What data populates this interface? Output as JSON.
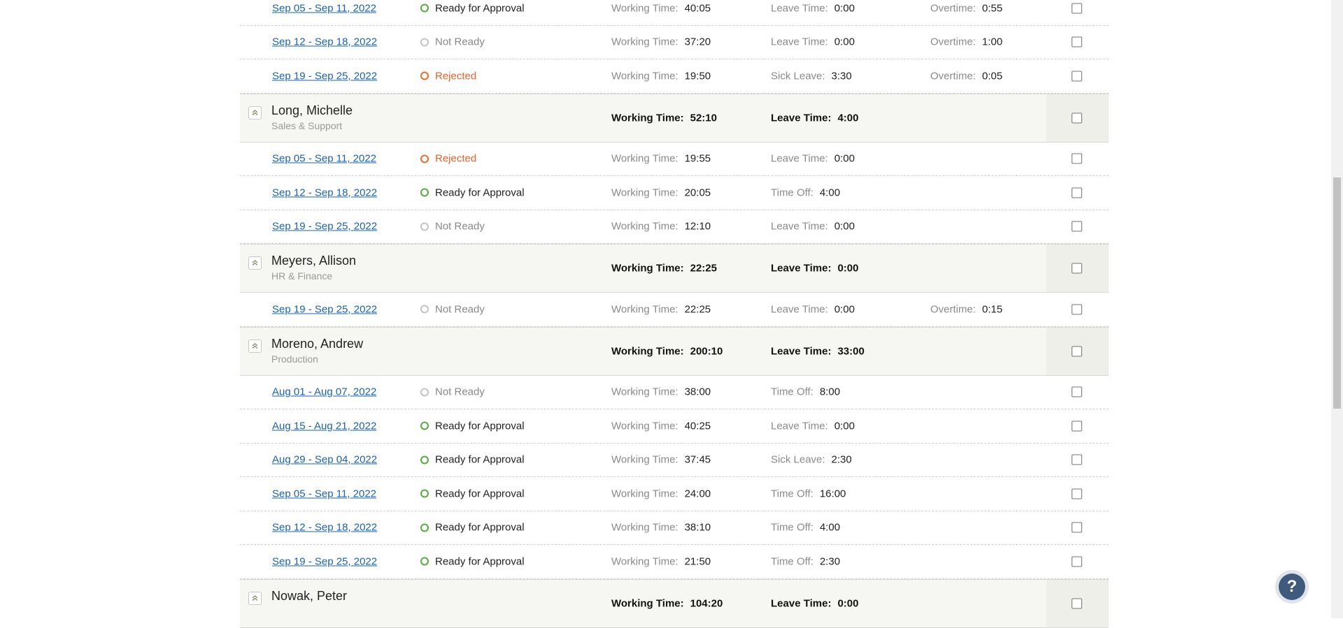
{
  "labels": {
    "working_time": "Working Time:",
    "leave_time": "Leave Time:",
    "overtime": "Overtime:",
    "sick_leave": "Sick Leave:",
    "time_off": "Time Off:"
  },
  "statuses": {
    "ready": "Ready for Approval",
    "not_ready": "Not Ready",
    "rejected": "Rejected"
  },
  "rows": [
    {
      "kind": "week",
      "date": "Sep 05 - Sep 11, 2022",
      "status": "Ready for Approval",
      "status_color": "green",
      "m1_label": "Working Time:",
      "m1_value": "40:05",
      "m2_label": "Leave Time:",
      "m2_value": "0:00",
      "m3_label": "Overtime:",
      "m3_value": "0:55"
    },
    {
      "kind": "week",
      "date": "Sep 12 - Sep 18, 2022",
      "status": "Not Ready",
      "status_color": "gray",
      "m1_label": "Working Time:",
      "m1_value": "37:20",
      "m2_label": "Leave Time:",
      "m2_value": "0:00",
      "m3_label": "Overtime:",
      "m3_value": "1:00"
    },
    {
      "kind": "week",
      "date": "Sep 19 - Sep 25, 2022",
      "status": "Rejected",
      "status_color": "orange",
      "m1_label": "Working Time:",
      "m1_value": "19:50",
      "m2_label": "Sick Leave:",
      "m2_value": "3:30",
      "m3_label": "Overtime:",
      "m3_value": "0:05"
    },
    {
      "kind": "employee",
      "name": "Long, Michelle",
      "dept": "Sales & Support",
      "m1_label": "Working Time:",
      "m1_value": "52:10",
      "m2_label": "Leave Time:",
      "m2_value": "4:00"
    },
    {
      "kind": "week",
      "date": "Sep 05 - Sep 11, 2022",
      "status": "Rejected",
      "status_color": "orange",
      "m1_label": "Working Time:",
      "m1_value": "19:55",
      "m2_label": "Leave Time:",
      "m2_value": "0:00"
    },
    {
      "kind": "week",
      "date": "Sep 12 - Sep 18, 2022",
      "status": "Ready for Approval",
      "status_color": "green",
      "m1_label": "Working Time:",
      "m1_value": "20:05",
      "m2_label": "Time Off:",
      "m2_value": "4:00"
    },
    {
      "kind": "week",
      "date": "Sep 19 - Sep 25, 2022",
      "status": "Not Ready",
      "status_color": "gray",
      "m1_label": "Working Time:",
      "m1_value": "12:10",
      "m2_label": "Leave Time:",
      "m2_value": "0:00"
    },
    {
      "kind": "employee",
      "name": "Meyers, Allison",
      "dept": "HR & Finance",
      "m1_label": "Working Time:",
      "m1_value": "22:25",
      "m2_label": "Leave Time:",
      "m2_value": "0:00"
    },
    {
      "kind": "week",
      "date": "Sep 19 - Sep 25, 2022",
      "status": "Not Ready",
      "status_color": "gray",
      "m1_label": "Working Time:",
      "m1_value": "22:25",
      "m2_label": "Leave Time:",
      "m2_value": "0:00",
      "m3_label": "Overtime:",
      "m3_value": "0:15"
    },
    {
      "kind": "employee",
      "name": "Moreno, Andrew",
      "dept": "Production",
      "m1_label": "Working Time:",
      "m1_value": "200:10",
      "m2_label": "Leave Time:",
      "m2_value": "33:00"
    },
    {
      "kind": "week",
      "date": "Aug 01 - Aug 07, 2022",
      "status": "Not Ready",
      "status_color": "gray",
      "m1_label": "Working Time:",
      "m1_value": "38:00",
      "m2_label": "Time Off:",
      "m2_value": "8:00"
    },
    {
      "kind": "week",
      "date": "Aug 15 - Aug 21, 2022",
      "status": "Ready for Approval",
      "status_color": "green",
      "m1_label": "Working Time:",
      "m1_value": "40:25",
      "m2_label": "Leave Time:",
      "m2_value": "0:00"
    },
    {
      "kind": "week",
      "date": "Aug 29 - Sep 04, 2022",
      "status": "Ready for Approval",
      "status_color": "green",
      "m1_label": "Working Time:",
      "m1_value": "37:45",
      "m2_label": "Sick Leave:",
      "m2_value": "2:30"
    },
    {
      "kind": "week",
      "date": "Sep 05 - Sep 11, 2022",
      "status": "Ready for Approval",
      "status_color": "green",
      "m1_label": "Working Time:",
      "m1_value": "24:00",
      "m2_label": "Time Off:",
      "m2_value": "16:00"
    },
    {
      "kind": "week",
      "date": "Sep 12 - Sep 18, 2022",
      "status": "Ready for Approval",
      "status_color": "green",
      "m1_label": "Working Time:",
      "m1_value": "38:10",
      "m2_label": "Time Off:",
      "m2_value": "4:00"
    },
    {
      "kind": "week",
      "date": "Sep 19 - Sep 25, 2022",
      "status": "Ready for Approval",
      "status_color": "green",
      "m1_label": "Working Time:",
      "m1_value": "21:50",
      "m2_label": "Time Off:",
      "m2_value": "2:30"
    },
    {
      "kind": "employee",
      "name": "Nowak, Peter",
      "dept": "",
      "m1_label": "Working Time:",
      "m1_value": "104:20",
      "m2_label": "Leave Time:",
      "m2_value": "0:00"
    }
  ],
  "help": {
    "icon": "question-icon",
    "glyph": "?"
  },
  "colors": {
    "link": "#1a63b0",
    "ready": "#58a842",
    "not_ready": "#c3c3c3",
    "rejected": "#e86b2f",
    "employee_band": "#f6f6f3",
    "help_button": "#3f5a7a"
  }
}
